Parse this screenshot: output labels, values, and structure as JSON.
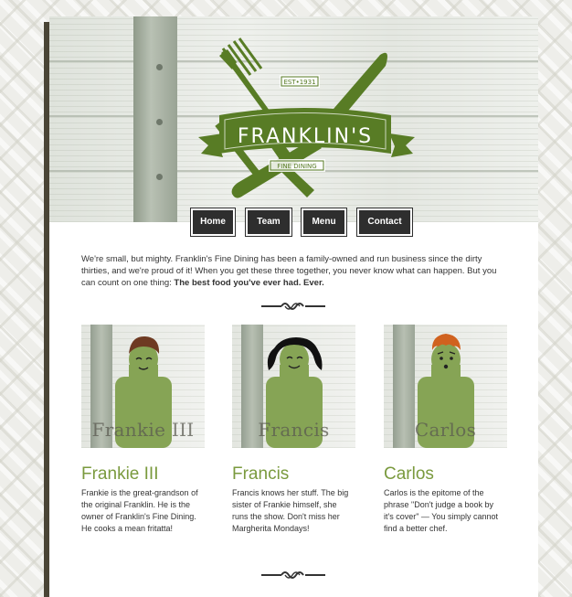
{
  "colors": {
    "brand_green": "#587c25",
    "nav_bg": "#2e2e2e",
    "heading_green": "#7a9a3e",
    "figure_green": "#86a455"
  },
  "logo": {
    "title": "FRANKLIN'S",
    "est": "EST•1931",
    "subtitle": "FINE DINING"
  },
  "nav": {
    "items": [
      {
        "label": "Home"
      },
      {
        "label": "Team"
      },
      {
        "label": "Menu"
      },
      {
        "label": "Contact"
      }
    ]
  },
  "intro": {
    "text": "We're small, but mighty. Franklin's Fine Dining has been a family-owned and run business since the dirty thirties, and we're proud of it! When you get these three together, you never know what can happen. But you can count on one thing: ",
    "emphasis": "The best food you've ever had. Ever."
  },
  "team": [
    {
      "name": "Frankie III",
      "bio": "Frankie is the great-grandson of the original Franklin. He is the owner of Franklin's Fine Dining. He cooks a mean fritatta!"
    },
    {
      "name": "Francis",
      "bio": "Francis knows her stuff. The big sister of Frankie himself, she runs the show. Don't miss her Margherita Mondays!"
    },
    {
      "name": "Carlos",
      "bio": "Carlos is the epitome of the phrase \"Don't judge a book by it's cover\" — You simply cannot find a better chef."
    }
  ],
  "icons": [
    "fork-icon",
    "knife-icon",
    "divider-ornament-icon"
  ]
}
